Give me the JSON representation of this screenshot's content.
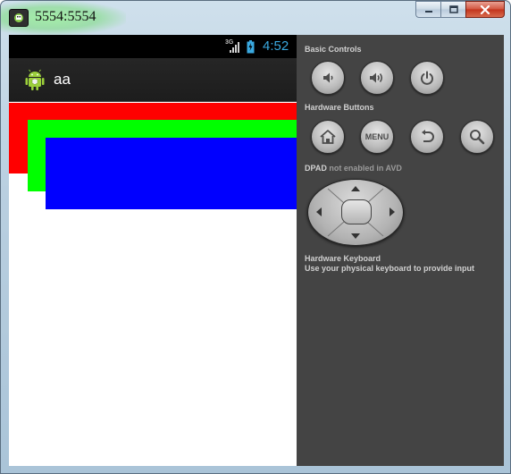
{
  "window": {
    "title": "5554:5554"
  },
  "status_bar": {
    "network": "3G",
    "time": "4:52"
  },
  "app": {
    "title": "aa"
  },
  "colors": {
    "red": "#ff0000",
    "green": "#00ff00",
    "blue": "#0000ff",
    "clock": "#3aa9e0"
  },
  "panel": {
    "basic_controls_label": "Basic Controls",
    "hardware_buttons_label": "Hardware Buttons",
    "menu_label": "MENU",
    "dpad_label": "DPAD",
    "dpad_note": "not enabled in AVD",
    "keyboard_title": "Hardware Keyboard",
    "keyboard_note": "Use your physical keyboard to provide input"
  },
  "icons": [
    "volume-down-icon",
    "volume-up-icon",
    "power-icon",
    "home-icon",
    "back-icon",
    "search-icon",
    "minimize-icon",
    "maximize-icon",
    "close-icon",
    "android-icon",
    "signal-icon",
    "battery-icon"
  ]
}
